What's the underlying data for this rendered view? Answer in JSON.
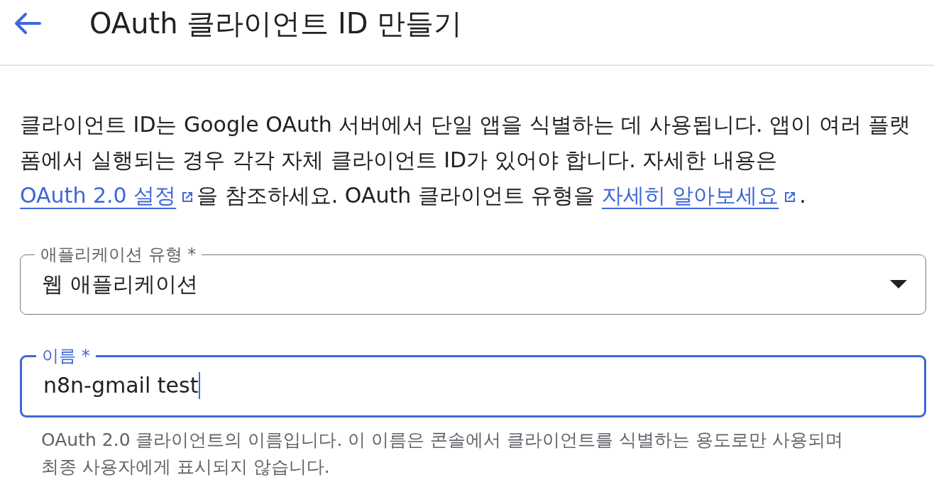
{
  "header": {
    "title": "OAuth 클라이언트 ID 만들기"
  },
  "description": {
    "parts": [
      {
        "kind": "text",
        "text": "클라이언트 ID는 Google OAuth 서버에서 단일 앱을 식별하는 데 사용됩니다. 앱이 여러 플랫폼에서 실행되는 경우 각각 자체 클라이언트 ID가 있어야 합니다. 자세한 내용은 "
      },
      {
        "kind": "link",
        "text": "OAuth 2.0 설정",
        "external": true
      },
      {
        "kind": "text",
        "text": "을 참조하세요. OAuth 클라이언트 유형을 "
      },
      {
        "kind": "link",
        "text": "자세히 알아보세요",
        "external": true
      },
      {
        "kind": "text",
        "text": "."
      }
    ]
  },
  "fields": [
    {
      "kind": "select",
      "label": "애플리케이션 유형 *",
      "value": "웹 애플리케이션",
      "focused": false
    },
    {
      "kind": "text",
      "label": "이름 *",
      "value": "n8n-gmail test",
      "focused": true,
      "hint": "OAuth 2.0 클라이언트의 이름입니다. 이 이름은 콘솔에서 클라이언트를 식별하는 용도로만 사용되며 최종 사용자에게 표시되지 않습니다."
    }
  ]
}
